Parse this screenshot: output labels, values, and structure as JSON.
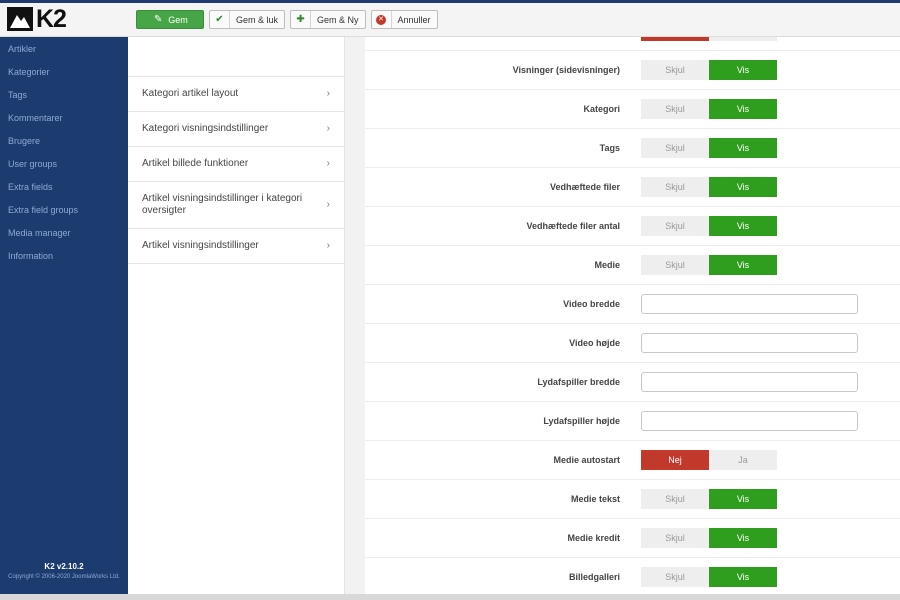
{
  "brand": {
    "logo_text": "K2"
  },
  "toolbar": {
    "save_label": "Gem",
    "save_close_label": "Gem & luk",
    "save_new_label": "Gem & Ny",
    "cancel_label": "Annuller"
  },
  "sidebar": {
    "items": [
      {
        "label": "Artikler"
      },
      {
        "label": "Kategorier"
      },
      {
        "label": "Tags"
      },
      {
        "label": "Kommentarer"
      },
      {
        "label": "Brugere"
      },
      {
        "label": "User groups"
      },
      {
        "label": "Extra fields"
      },
      {
        "label": "Extra field groups"
      },
      {
        "label": "Media manager"
      },
      {
        "label": "Information"
      }
    ],
    "version": "K2 v2.10.2",
    "copyright": "Copyright © 2006-2020 JoomlaWorks Ltd."
  },
  "menu": {
    "items": [
      {
        "label": "Kategori artikel layout"
      },
      {
        "label": "Kategori visningsindstillinger"
      },
      {
        "label": "Artikel billede funktioner"
      },
      {
        "label": "Artikel visningsindstillinger i kategori oversigter"
      },
      {
        "label": "Artikel visningsindstillinger"
      }
    ]
  },
  "settings": {
    "rows": [
      {
        "label": "",
        "type": "toggle",
        "off": "",
        "on": "",
        "state": "red"
      },
      {
        "label": "Visninger (sidevisninger)",
        "type": "toggle",
        "off": "Skjul",
        "on": "Vis"
      },
      {
        "label": "Kategori",
        "type": "toggle",
        "off": "Skjul",
        "on": "Vis"
      },
      {
        "label": "Tags",
        "type": "toggle",
        "off": "Skjul",
        "on": "Vis"
      },
      {
        "label": "Vedhæftede filer",
        "type": "toggle",
        "off": "Skjul",
        "on": "Vis"
      },
      {
        "label": "Vedhæftede filer antal",
        "type": "toggle",
        "off": "Skjul",
        "on": "Vis"
      },
      {
        "label": "Medie",
        "type": "toggle",
        "off": "Skjul",
        "on": "Vis"
      },
      {
        "label": "Video bredde",
        "type": "input",
        "value": ""
      },
      {
        "label": "Video højde",
        "type": "input",
        "value": ""
      },
      {
        "label": "Lydafspiller bredde",
        "type": "input",
        "value": ""
      },
      {
        "label": "Lydafspiller højde",
        "type": "input",
        "value": ""
      },
      {
        "label": "Medie autostart",
        "type": "toggle",
        "off": "Nej",
        "on": "Ja",
        "state": "no"
      },
      {
        "label": "Medie tekst",
        "type": "toggle",
        "off": "Skjul",
        "on": "Vis"
      },
      {
        "label": "Medie kredit",
        "type": "toggle",
        "off": "Skjul",
        "on": "Vis"
      },
      {
        "label": "Billedgalleri",
        "type": "toggle",
        "off": "Skjul",
        "on": "Vis"
      }
    ]
  },
  "colors": {
    "sidebar_bg": "#1c3b6e",
    "primary_green": "#46a546",
    "toggle_on": "#2f9e1e",
    "toggle_no": "#c0392b"
  }
}
